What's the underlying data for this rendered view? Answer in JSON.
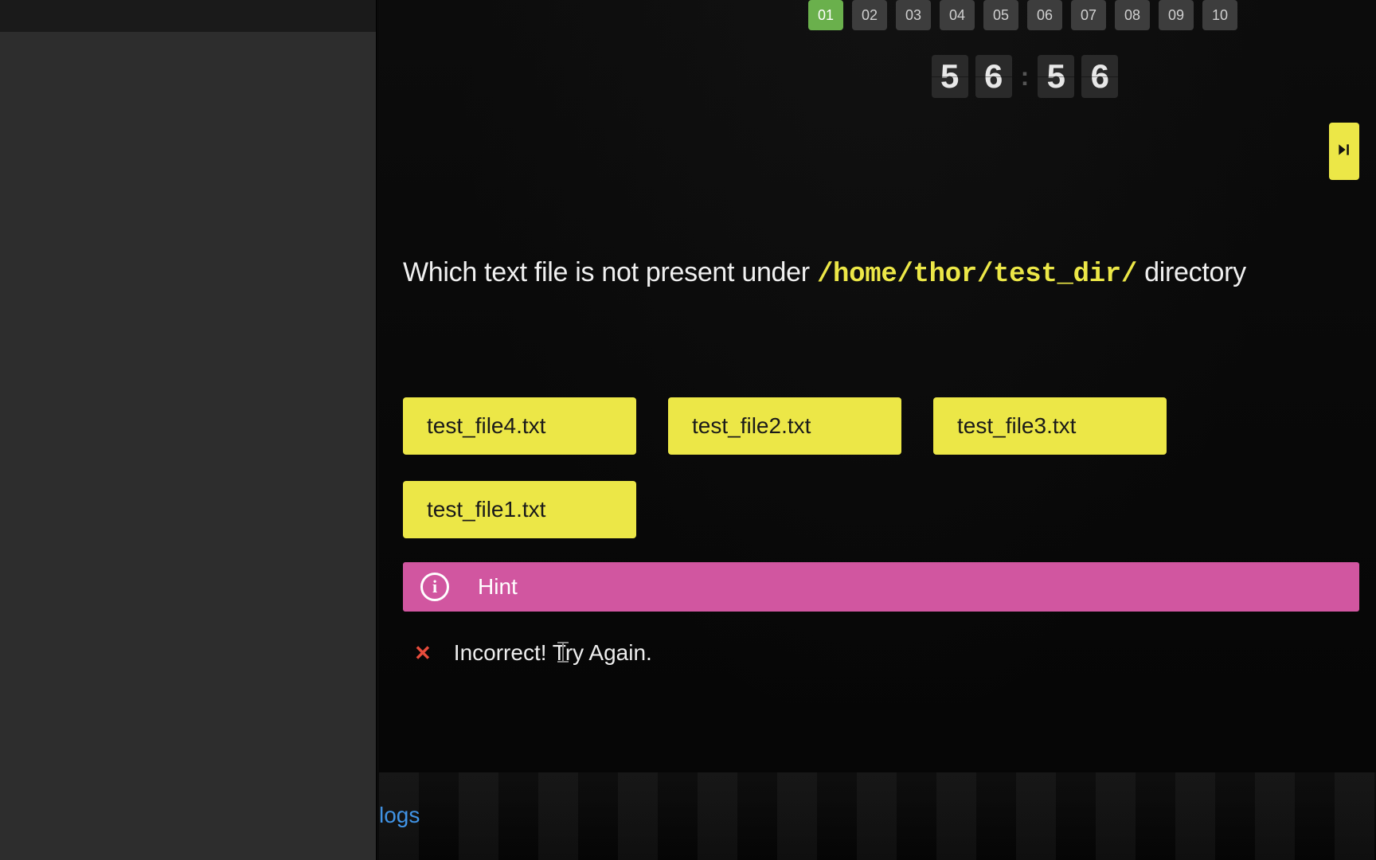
{
  "steps": [
    {
      "n": "01",
      "active": true
    },
    {
      "n": "02",
      "active": false
    },
    {
      "n": "03",
      "active": false
    },
    {
      "n": "04",
      "active": false
    },
    {
      "n": "05",
      "active": false
    },
    {
      "n": "06",
      "active": false
    },
    {
      "n": "07",
      "active": false
    },
    {
      "n": "08",
      "active": false
    },
    {
      "n": "09",
      "active": false
    },
    {
      "n": "10",
      "active": false
    }
  ],
  "timer": {
    "d1": "5",
    "d2": "6",
    "d3": "5",
    "d4": "6"
  },
  "question": {
    "prefix": "Which text file is not present under ",
    "code": "/home/thor/test_dir/",
    "suffix": " directory"
  },
  "answers": [
    "test_file4.txt",
    "test_file2.txt",
    "test_file3.txt",
    "test_file1.txt"
  ],
  "hint": {
    "label": "Hint",
    "icon": "i"
  },
  "feedback": {
    "icon": "✕",
    "text": "Incorrect! Try Again."
  },
  "logs_label": "logs",
  "colors": {
    "accent_yellow": "#ece747",
    "accent_green": "#6ab04c",
    "accent_pink": "#d156a0",
    "error": "#e74c3c",
    "link": "#3b9eff"
  }
}
